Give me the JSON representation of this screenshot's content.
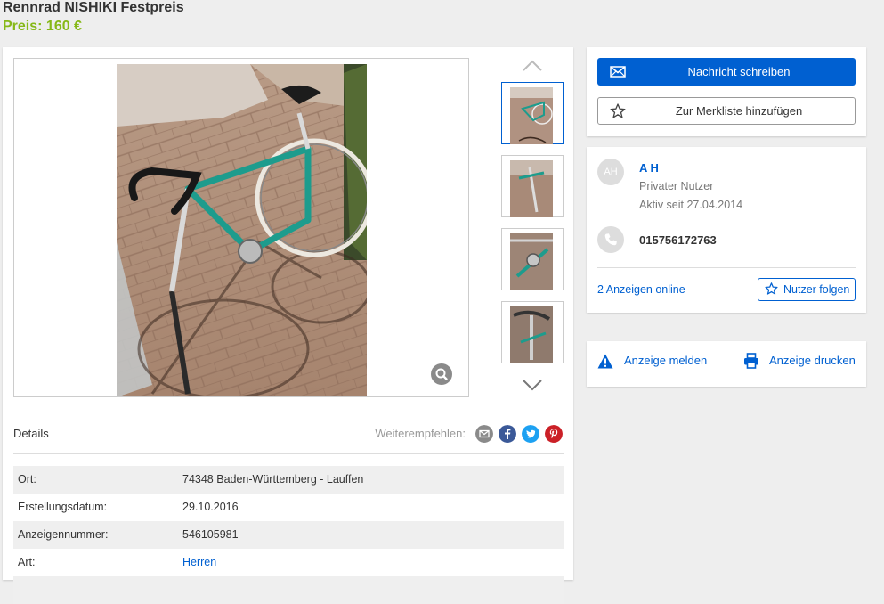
{
  "listing": {
    "title": "Rennrad NISHIKI Festpreis",
    "price": "Preis: 160 €"
  },
  "gallery": {
    "zoom_icon": "magnifier-icon",
    "thumbnail_count": 4,
    "active_thumbnail": 1
  },
  "details": {
    "heading": "Details",
    "share_label": "Weiterempfehlen:",
    "share_icons": [
      "email-icon",
      "facebook-icon",
      "twitter-icon",
      "pinterest-icon"
    ],
    "rows": [
      {
        "key": "Ort:",
        "value": "74348 Baden-Württemberg - Lauffen"
      },
      {
        "key": "Erstellungsdatum:",
        "value": "29.10.2016"
      },
      {
        "key": "Anzeigennummer:",
        "value": "546105981"
      },
      {
        "key": "Art:",
        "value": "Herren"
      }
    ]
  },
  "actions": {
    "message_button": "Nachricht schreiben",
    "watchlist_button": "Zur Merkliste hinzufügen"
  },
  "seller": {
    "avatar_initials": "AH",
    "name": "A H",
    "type": "Privater Nutzer",
    "active_since": "Aktiv seit 27.04.2014",
    "phone": "015756172763",
    "ads_online": "2 Anzeigen online",
    "follow_button": "Nutzer folgen"
  },
  "tools": {
    "report": "Anzeige melden",
    "print": "Anzeige drucken"
  },
  "colors": {
    "accent": "#0060d1",
    "price": "#86b817",
    "page_bg": "#eeeeee"
  }
}
